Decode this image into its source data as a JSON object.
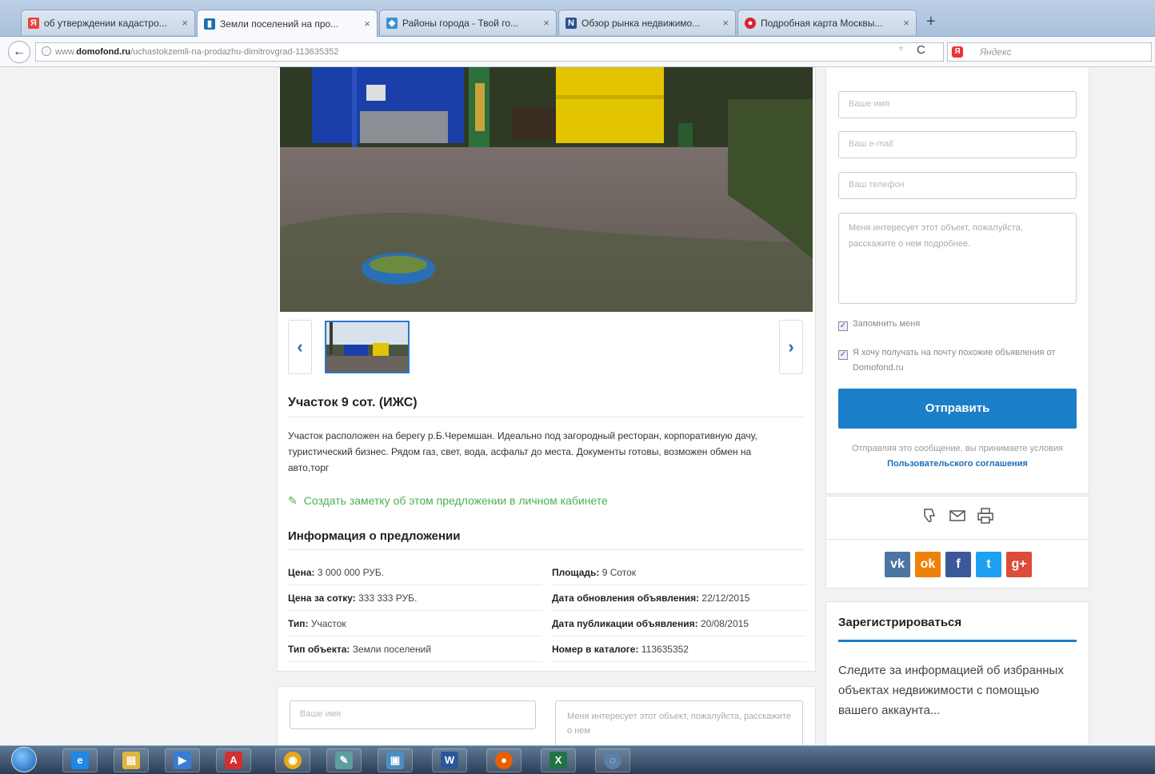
{
  "browser": {
    "tabs": [
      {
        "label": "об утверждении кадастро...",
        "close": "×",
        "icon_text": "Я",
        "icon_color": "#e8453c"
      },
      {
        "label": "Земли поселений на про...",
        "close": "×",
        "icon_text": "▮",
        "icon_color": "#1b6fb5"
      },
      {
        "label": "Районы города - Твой го...",
        "close": "×",
        "icon_text": "◆",
        "icon_color": "#3a8fd0"
      },
      {
        "label": "Обзор рынка недвижимо...",
        "close": "×",
        "icon_text": "N",
        "icon_color": "#2d4f8f"
      },
      {
        "label": "Подробная карта Москвы...",
        "close": "×",
        "icon_text": "●",
        "icon_color": "#d9252a"
      }
    ],
    "new_tab": "+",
    "back": "←",
    "url_prefix": "www.",
    "url_domain": "domofond.ru",
    "url_path": "/uchastokzemli-na-prodazhu-dimitrovgrad-113635352",
    "reload": "C",
    "dropdown_arrow": "▿",
    "search_placeholder": "Яндекс",
    "search_engine_letter": "Я"
  },
  "gallery": {
    "prev": "‹",
    "next": "›"
  },
  "listing": {
    "title": "Участок 9 сот. (ИЖС)",
    "description": "Участок расположен на берегу р.Б.Черемшан. Идеально под загородный ресторан, корпоративную дачу, туристический бизнес. Рядом газ, свет, вода, асфальт до места. Документы готовы, возможен обмен на авто,торг",
    "note_icon": "✎",
    "note_link": "Создать заметку об этом предложении в личном кабинете",
    "info_heading": "Информация о предложении",
    "info": {
      "left": [
        {
          "label": "Цена:",
          "value": " 3 000 000 РУБ."
        },
        {
          "label": "Цена за сотку:",
          "value": " 333 333 РУБ."
        },
        {
          "label": "Тип:",
          "value": " Участок"
        },
        {
          "label": "Тип объекта:",
          "value": " Земли поселений"
        }
      ],
      "right": [
        {
          "label": "Площадь:",
          "value": " 9 Соток"
        },
        {
          "label": "Дата обновления объявления:",
          "value": " 22/12/2015"
        },
        {
          "label": "Дата публикации объявления:",
          "value": " 20/08/2015"
        },
        {
          "label": "Номер в каталоге:",
          "value": " 113635352"
        }
      ]
    }
  },
  "contact_form": {
    "name_placeholder": "Ваше имя",
    "email_placeholder": "Ваш e-mail",
    "phone_placeholder": "Ваш телефон",
    "message": "Меня интересует этот объект, пожалуйста, расскажите о нем подробнее.",
    "remember_me": "Запомнить меня",
    "subscribe": "Я хочу получать на почту похожие объявления от Domofond.ru",
    "checkmark": "✓",
    "submit": "Отправить",
    "agree_text": "Отправляя это сообщение, вы принимаете условия ",
    "agree_link": "Пользовательского соглашения"
  },
  "actions": {
    "icons": [
      "dislike-icon",
      "mail-icon",
      "print-icon"
    ],
    "social": [
      {
        "name": "vk-icon",
        "glyph": "vk",
        "color": "#4c75a3"
      },
      {
        "name": "odnoklassniki-icon",
        "glyph": "ok",
        "color": "#ee8208"
      },
      {
        "name": "facebook-icon",
        "glyph": "f",
        "color": "#3b5998"
      },
      {
        "name": "twitter-icon",
        "glyph": "t",
        "color": "#1da1f2"
      },
      {
        "name": "google-plus-icon",
        "glyph": "g+",
        "color": "#dd4b39"
      }
    ]
  },
  "register": {
    "title": "Зарегистрироваться",
    "text": "Следите за информацией об избранных объектах недвижимости с помощью вашего аккаунта..."
  },
  "bottom_form": {
    "name_placeholder": "Ваше имя",
    "message": "Меня интересует этот объект, пожалуйста, расскажите о нем"
  },
  "taskbar": {
    "apps": [
      {
        "name": "ie-icon",
        "glyph": "e",
        "color": "#1e88e5"
      },
      {
        "name": "explorer-icon",
        "glyph": "▤",
        "color": "#e0b640"
      },
      {
        "name": "media-player-icon",
        "glyph": "▶",
        "color": "#3a7bd5"
      },
      {
        "name": "acrobat-icon",
        "glyph": "A",
        "color": "#d32f2f"
      },
      {
        "name": "chrome-icon",
        "glyph": "◉",
        "color": "#e7a91a"
      },
      {
        "name": "paint-icon",
        "glyph": "✎",
        "color": "#5f9ea0"
      },
      {
        "name": "screen-icon",
        "glyph": "▣",
        "color": "#4a8fc4"
      },
      {
        "name": "word-icon",
        "glyph": "W",
        "color": "#2b579a"
      },
      {
        "name": "firefox-icon",
        "glyph": "●",
        "color": "#e66000"
      },
      {
        "name": "excel-icon",
        "glyph": "X",
        "color": "#217346"
      },
      {
        "name": "app-icon",
        "glyph": "◌",
        "color": "#5a7fa8"
      }
    ]
  }
}
